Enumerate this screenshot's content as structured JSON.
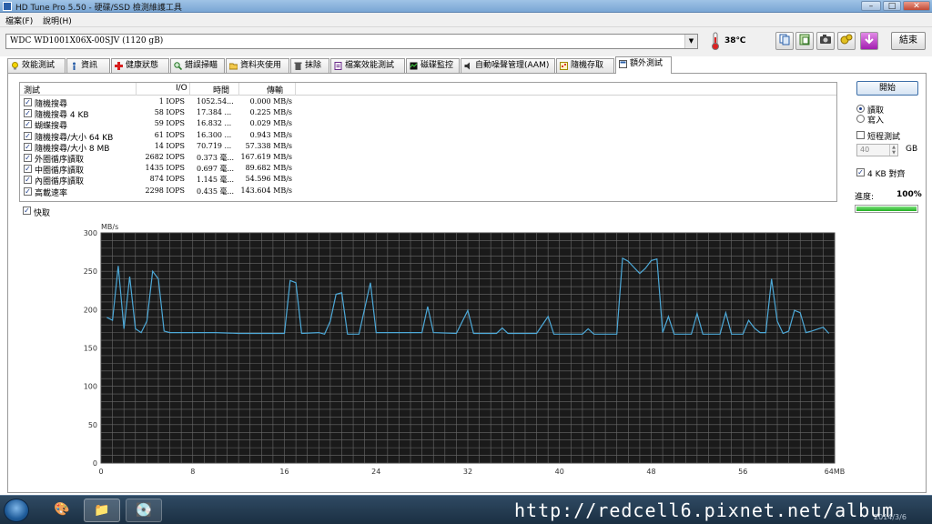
{
  "window": {
    "title": "HD Tune Pro 5.50 - 硬碟/SSD 檢測維護工具"
  },
  "menu": [
    {
      "label": "檔案(F)"
    },
    {
      "label": "說明(H)"
    }
  ],
  "toolbar": {
    "drive": "WDC WD1001X06X-00SJV (1120 gB)",
    "temperature": "38℃",
    "exit_label": "結束",
    "icons": [
      "copy-icon",
      "paste-icon",
      "camera-icon",
      "settings-icon",
      "download-icon"
    ]
  },
  "tabs": [
    {
      "label": "效能測試",
      "icon": "bulb-icon"
    },
    {
      "label": "資訊",
      "icon": "info-icon"
    },
    {
      "label": "健康狀態",
      "icon": "health-cross-icon"
    },
    {
      "label": "錯誤掃瞄",
      "icon": "magnifier-icon"
    },
    {
      "label": "資料夾使用",
      "icon": "folder-icon"
    },
    {
      "label": "抹除",
      "icon": "trash-icon"
    },
    {
      "label": "檔案效能測試",
      "icon": "file-benchmark-icon"
    },
    {
      "label": "磁碟監控",
      "icon": "monitor-icon"
    },
    {
      "label": "自動噪聲管理(AAM)",
      "icon": "speaker-icon"
    },
    {
      "label": "隨機存取",
      "icon": "random-access-icon"
    },
    {
      "label": "額外測試",
      "icon": "extra-tests-icon",
      "active": true
    }
  ],
  "results": {
    "headers": {
      "test": "測試",
      "io": "I/O",
      "time": "時間",
      "transfer": "傳輸"
    },
    "rows": [
      {
        "name": "隨機搜尋",
        "io": "1 IOPS",
        "time": "1052.54...",
        "transfer": "0.000 MB/s"
      },
      {
        "name": "隨機搜尋 4 KB",
        "io": "58 IOPS",
        "time": "17.384 ...",
        "transfer": "0.225 MB/s"
      },
      {
        "name": "蝴蝶搜尋",
        "io": "59 IOPS",
        "time": "16.832 ...",
        "transfer": "0.029 MB/s"
      },
      {
        "name": "隨機搜尋/大小 64 KB",
        "io": "61 IOPS",
        "time": "16.300 ...",
        "transfer": "0.943 MB/s"
      },
      {
        "name": "隨機搜尋/大小 8 MB",
        "io": "14 IOPS",
        "time": "70.719 ...",
        "transfer": "57.338 MB/s"
      },
      {
        "name": "外圈循序讀取",
        "io": "2682 IOPS",
        "time": "0.373 毫...",
        "transfer": "167.619 MB/s"
      },
      {
        "name": "中圈循序讀取",
        "io": "1435 IOPS",
        "time": "0.697 毫...",
        "transfer": "89.682 MB/s"
      },
      {
        "name": "內圈循序讀取",
        "io": "874 IOPS",
        "time": "1.145 毫...",
        "transfer": "54.596 MB/s"
      },
      {
        "name": "高載速率",
        "io": "2298 IOPS",
        "time": "0.435 毫...",
        "transfer": "143.604 MB/s"
      }
    ]
  },
  "cache_label": "快取",
  "side": {
    "start_label": "開始",
    "read_label": "讀取",
    "write_label": "寫入",
    "short_test_label": "短程測試",
    "short_value": "40",
    "short_unit": "GB",
    "align_label": "4 KB 對齊",
    "progress_label": "進度:",
    "progress_text": "100%",
    "progress_fraction": 1.0
  },
  "chart_data": {
    "type": "line",
    "ylabel": "MB/s",
    "xunit_label": "64MB",
    "xlim": [
      0,
      64
    ],
    "ylim": [
      0,
      300
    ],
    "yticks": [
      0,
      50,
      100,
      150,
      200,
      250,
      300
    ],
    "xticks": [
      0,
      8,
      16,
      24,
      32,
      40,
      48,
      56,
      64
    ],
    "x_tick_labels": [
      "0",
      "8",
      "16",
      "24",
      "32",
      "40",
      "48",
      "56",
      "64MB"
    ],
    "grid": true,
    "colors": {
      "background": "#1a1a1a",
      "grid": "#6a6a6a",
      "line": "#4da9d8"
    },
    "series": [
      {
        "values": [
          [
            0.5,
            190
          ],
          [
            1,
            186
          ],
          [
            1.5,
            257
          ],
          [
            2,
            175
          ],
          [
            2.5,
            243
          ],
          [
            3,
            175
          ],
          [
            3.5,
            170
          ],
          [
            4,
            185
          ],
          [
            4.5,
            250
          ],
          [
            5,
            240
          ],
          [
            5.5,
            172
          ],
          [
            6,
            170
          ],
          [
            8,
            170
          ],
          [
            10,
            170
          ],
          [
            12,
            169
          ],
          [
            14,
            169
          ],
          [
            16,
            169
          ],
          [
            16.5,
            238
          ],
          [
            17,
            235
          ],
          [
            17.5,
            169
          ],
          [
            19,
            170
          ],
          [
            19.5,
            168
          ],
          [
            20,
            185
          ],
          [
            20.5,
            220
          ],
          [
            21,
            222
          ],
          [
            21.5,
            168
          ],
          [
            22.5,
            168
          ],
          [
            23.5,
            235
          ],
          [
            24,
            170
          ],
          [
            26,
            170
          ],
          [
            28,
            170
          ],
          [
            28.5,
            204
          ],
          [
            29,
            170
          ],
          [
            31,
            169
          ],
          [
            32,
            199
          ],
          [
            32.5,
            169
          ],
          [
            34.5,
            169
          ],
          [
            35,
            176
          ],
          [
            35.5,
            169
          ],
          [
            38,
            169
          ],
          [
            39,
            191
          ],
          [
            39.5,
            168
          ],
          [
            42,
            168
          ],
          [
            42.5,
            175
          ],
          [
            43,
            168
          ],
          [
            45,
            168
          ],
          [
            45.5,
            267
          ],
          [
            46,
            263
          ],
          [
            46.5,
            255
          ],
          [
            47,
            247
          ],
          [
            47.5,
            254
          ],
          [
            48,
            264
          ],
          [
            48.5,
            266
          ],
          [
            49,
            170
          ],
          [
            49.5,
            191
          ],
          [
            50,
            168
          ],
          [
            51.5,
            168
          ],
          [
            52,
            195
          ],
          [
            52.5,
            168
          ],
          [
            54,
            168
          ],
          [
            54.5,
            196
          ],
          [
            55,
            168
          ],
          [
            56,
            168
          ],
          [
            56.5,
            186
          ],
          [
            57,
            176
          ],
          [
            57.5,
            170
          ],
          [
            58,
            170
          ],
          [
            58.5,
            240
          ],
          [
            59,
            185
          ],
          [
            59.5,
            169
          ],
          [
            60,
            172
          ],
          [
            60.5,
            199
          ],
          [
            61,
            196
          ],
          [
            61.5,
            170
          ],
          [
            62,
            172
          ],
          [
            63,
            177
          ],
          [
            63.5,
            169
          ]
        ]
      }
    ]
  },
  "taskbar": {
    "watermark": "http://redcell6.pixnet.net/album",
    "clock": "2014/3/6"
  }
}
